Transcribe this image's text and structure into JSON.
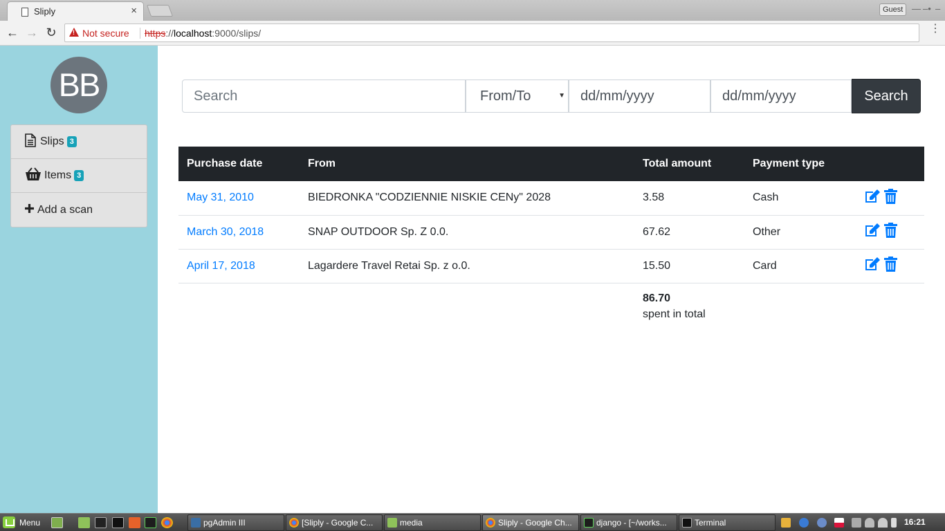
{
  "browser": {
    "tab_title": "Sliply",
    "tab_close": "×",
    "guest_label": "Guest",
    "security_label": "Not secure",
    "url_scheme": "https",
    "url_sep": "://",
    "url_host": "localhost",
    "url_rest": ":9000/slips/"
  },
  "sidebar": {
    "avatar_initials": "BB",
    "items": [
      {
        "label": "Slips",
        "badge": "3",
        "icon": "file-icon"
      },
      {
        "label": "Items",
        "badge": "3",
        "icon": "basket-icon"
      },
      {
        "label": "Add a scan",
        "badge": "",
        "icon": "plus-icon"
      }
    ]
  },
  "search": {
    "placeholder": "Search",
    "direction_value": "From/To",
    "date_from_placeholder": "dd/mm/yyyy",
    "date_to_placeholder": "dd/mm/yyyy",
    "button_label": "Search"
  },
  "table": {
    "headers": [
      "Purchase date",
      "From",
      "Total amount",
      "Payment type"
    ],
    "rows": [
      {
        "date": "May 31, 2010",
        "from": "BIEDRONKA \"CODZIENNIE NISKIE CENy\" 2028",
        "total": "3.58",
        "payment": "Cash"
      },
      {
        "date": "March 30, 2018",
        "from": "SNAP OUTDOOR Sp. Z 0.0.",
        "total": "67.62",
        "payment": "Other"
      },
      {
        "date": "April 17, 2018",
        "from": "Lagardere Travel Retai Sp. z o.0.",
        "total": "15.50",
        "payment": "Card"
      }
    ],
    "total_value": "86.70",
    "total_label": "spent in total"
  },
  "taskbar": {
    "menu_label": "Menu",
    "tasks": [
      {
        "label": "pgAdmin III"
      },
      {
        "label": "[Sliply - Google C..."
      },
      {
        "label": "media"
      },
      {
        "label": "Sliply - Google Ch..."
      },
      {
        "label": "django - [~/works..."
      },
      {
        "label": "Terminal"
      }
    ],
    "clock": "16:21"
  },
  "colors": {
    "sidebar_bg": "#9ad4df",
    "link": "#007bff",
    "header_dark": "#212529",
    "badge": "#17a2b8",
    "avatar": "#6c757d"
  }
}
